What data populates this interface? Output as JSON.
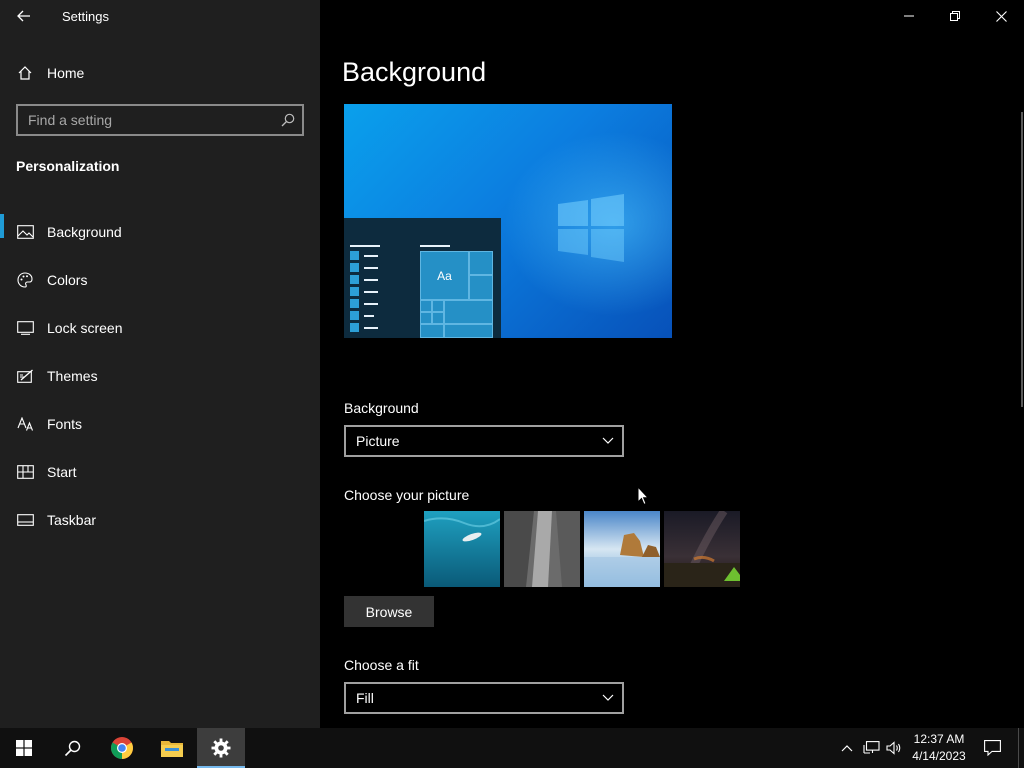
{
  "window": {
    "title": "Settings"
  },
  "sidebar": {
    "home_label": "Home",
    "search_placeholder": "Find a setting",
    "section_title": "Personalization",
    "items": [
      {
        "label": "Background",
        "icon": "picture-icon",
        "active": true
      },
      {
        "label": "Colors",
        "icon": "palette-icon",
        "active": false
      },
      {
        "label": "Lock screen",
        "icon": "lock-screen-icon",
        "active": false
      },
      {
        "label": "Themes",
        "icon": "themes-icon",
        "active": false
      },
      {
        "label": "Fonts",
        "icon": "fonts-icon",
        "active": false
      },
      {
        "label": "Start",
        "icon": "start-icon",
        "active": false
      },
      {
        "label": "Taskbar",
        "icon": "taskbar-icon",
        "active": false
      }
    ]
  },
  "main": {
    "title": "Background",
    "preview": {
      "tile_label": "Aa"
    },
    "background_label": "Background",
    "background_value": "Picture",
    "choose_picture_label": "Choose your picture",
    "pictures": [
      "underwater-swimmer",
      "rock-cliff",
      "beach-rocks",
      "night-sky-tent"
    ],
    "browse_label": "Browse",
    "fit_label": "Choose a fit",
    "fit_value": "Fill"
  },
  "taskbar": {
    "apps": [
      "start-icon",
      "search-icon",
      "chrome-icon",
      "file-explorer-icon",
      "settings-icon"
    ],
    "active_app": "settings-icon",
    "clock_time": "12:37 AM",
    "clock_date": "4/14/2023"
  },
  "colors": {
    "accent": "#1f9bd6",
    "sidebar_bg": "#1f1f1f",
    "content_bg": "#000000",
    "taskbar_bg": "#101010"
  }
}
